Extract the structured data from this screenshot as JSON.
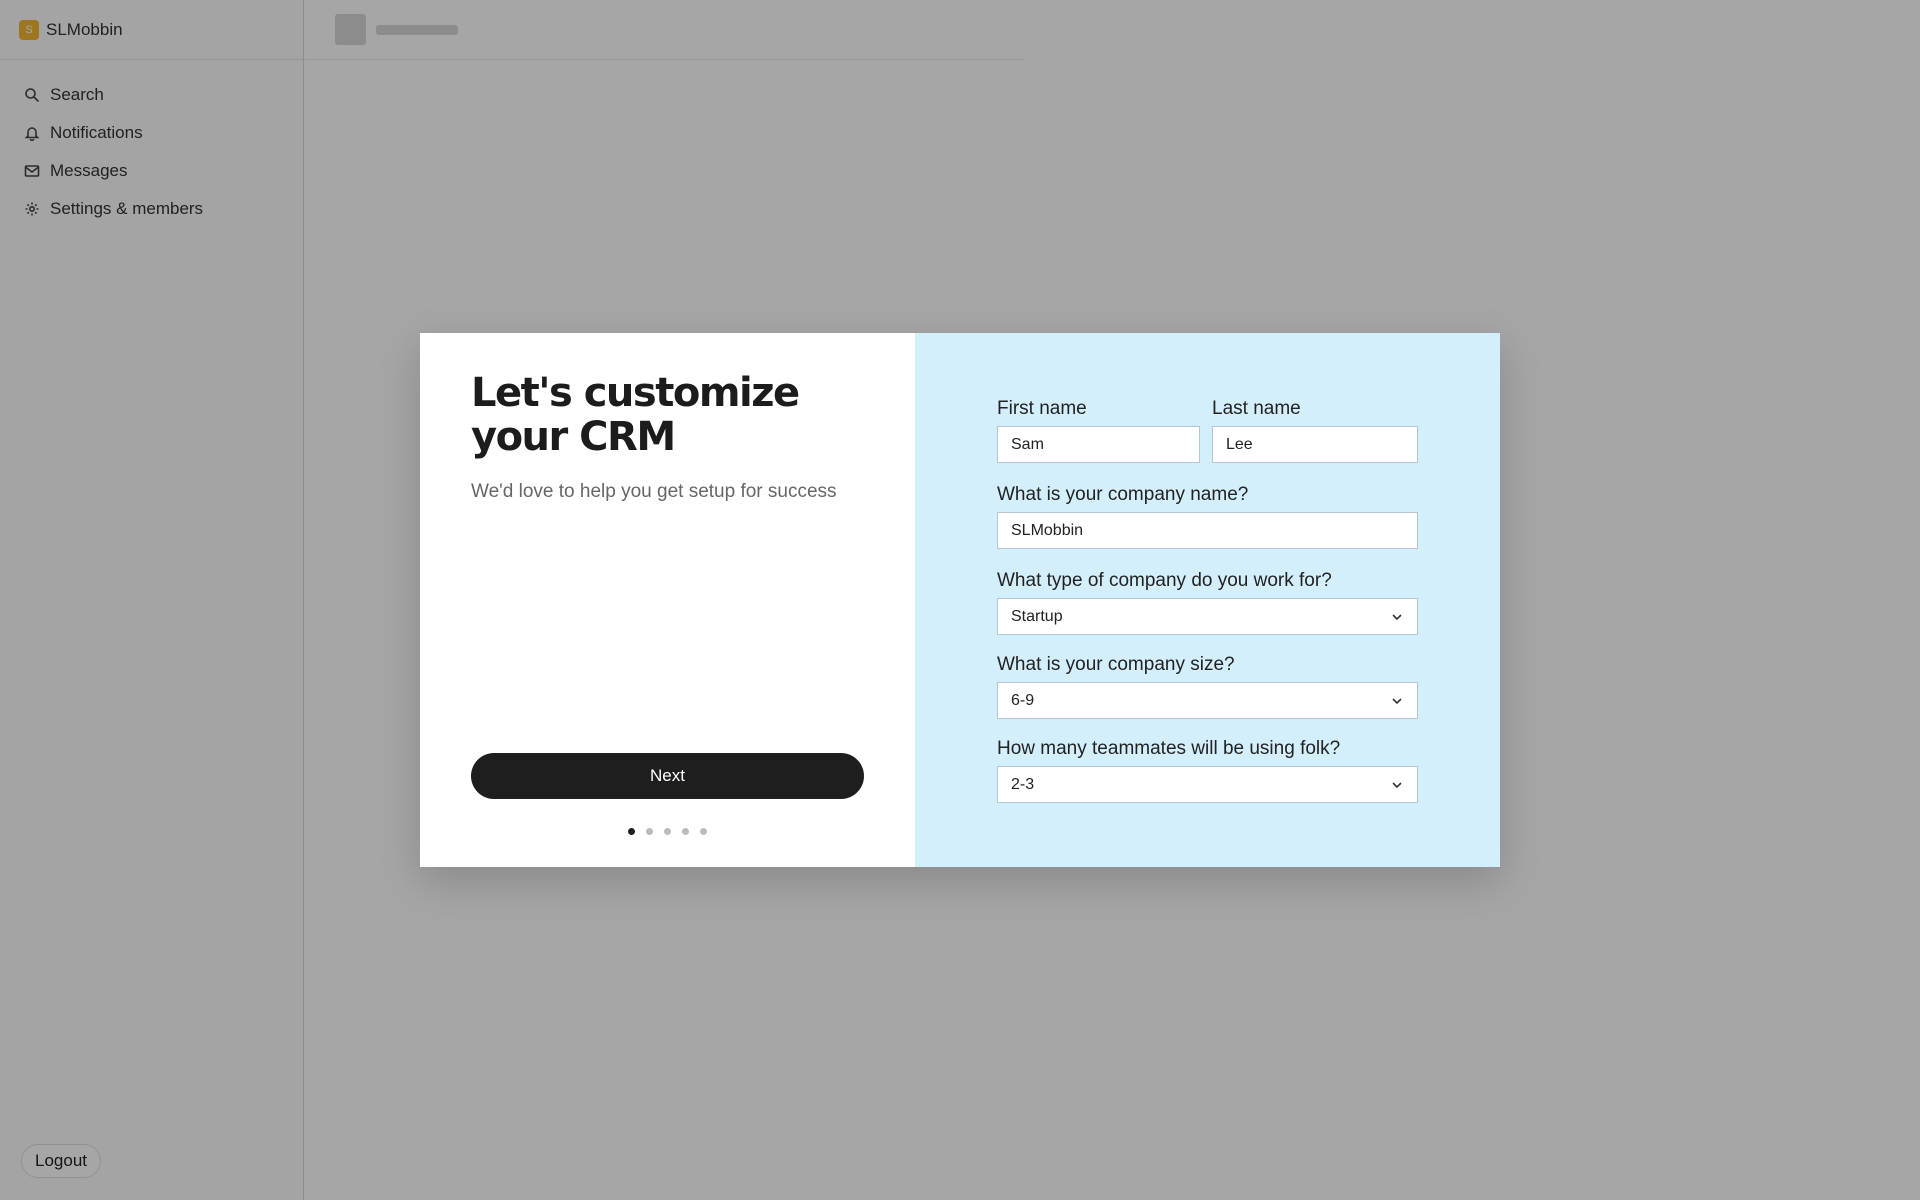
{
  "workspace": {
    "name": "SLMobbin",
    "logo_letter": "S",
    "accent_color": "#f2b630"
  },
  "sidebar": {
    "items": [
      {
        "label": "Search",
        "icon": "search-icon"
      },
      {
        "label": "Notifications",
        "icon": "bell-icon"
      },
      {
        "label": "Messages",
        "icon": "mail-icon"
      },
      {
        "label": "Settings & members",
        "icon": "gear-icon"
      }
    ],
    "logout_label": "Logout"
  },
  "modal": {
    "title": "Let's customize your CRM",
    "subtitle": "We'd love to help you get setup for success",
    "next_label": "Next",
    "steps_total": 5,
    "current_step": 1,
    "form": {
      "first_name": {
        "label": "First name",
        "value": "Sam"
      },
      "last_name": {
        "label": "Last name",
        "value": "Lee"
      },
      "company_name": {
        "label": "What is your company name?",
        "value": "SLMobbin"
      },
      "company_type": {
        "label": "What type of company do you work for?",
        "value": "Startup"
      },
      "company_size": {
        "label": "What is your company size?",
        "value": "6-9"
      },
      "teammates": {
        "label": "How many teammates will be using folk?",
        "value": "2-3"
      }
    },
    "right_panel_color": "#d4effc"
  }
}
